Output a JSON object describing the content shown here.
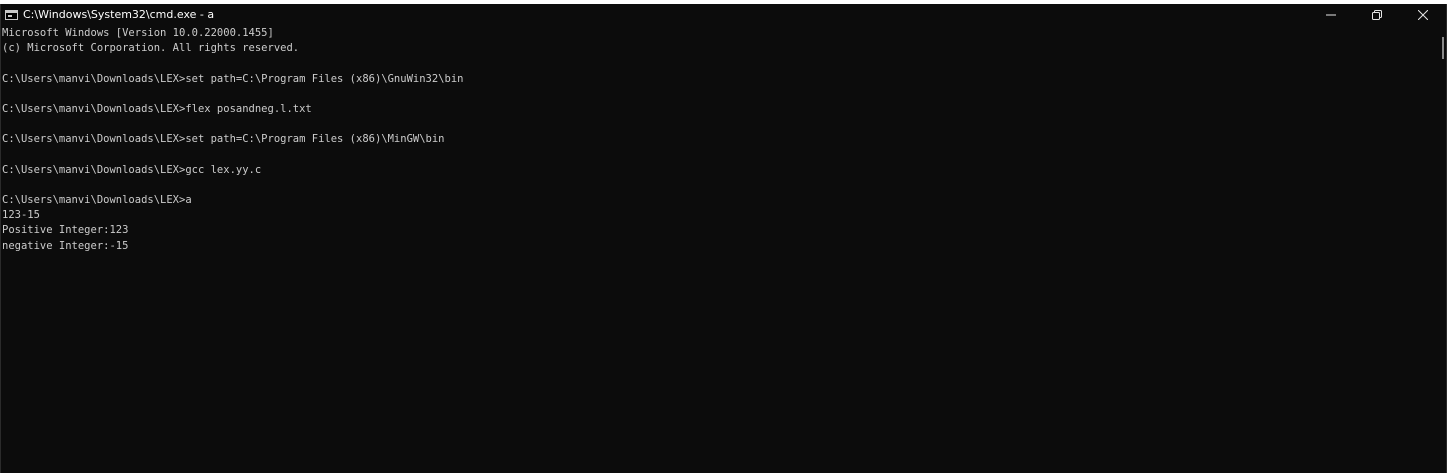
{
  "window": {
    "title": "C:\\Windows\\System32\\cmd.exe - a",
    "icon": "cmd-console-icon",
    "controls": {
      "minimize_icon": "minimize-icon",
      "maximize_icon": "restore-icon",
      "close_icon": "close-icon"
    }
  },
  "terminal": {
    "background_color": "#0c0c0c",
    "text_color": "#cccccc",
    "lines": [
      "Microsoft Windows [Version 10.0.22000.1455]",
      "(c) Microsoft Corporation. All rights reserved.",
      "",
      "C:\\Users\\manvi\\Downloads\\LEX>set path=C:\\Program Files (x86)\\GnuWin32\\bin",
      "",
      "C:\\Users\\manvi\\Downloads\\LEX>flex posandneg.l.txt",
      "",
      "C:\\Users\\manvi\\Downloads\\LEX>set path=C:\\Program Files (x86)\\MinGW\\bin",
      "",
      "C:\\Users\\manvi\\Downloads\\LEX>gcc lex.yy.c",
      "",
      "C:\\Users\\manvi\\Downloads\\LEX>a",
      "123-15",
      "Positive Integer:123",
      "negative Integer:-15"
    ]
  }
}
